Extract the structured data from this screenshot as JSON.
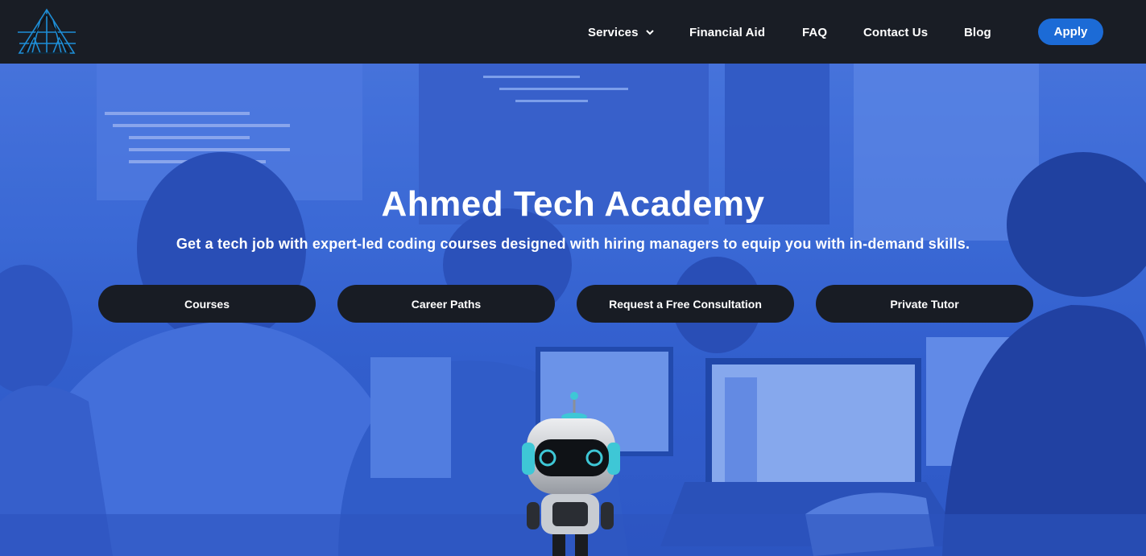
{
  "nav": {
    "items": [
      {
        "label": "Services",
        "has_dropdown": true
      },
      {
        "label": "Financial Aid"
      },
      {
        "label": "FAQ"
      },
      {
        "label": "Contact Us"
      },
      {
        "label": "Blog"
      }
    ],
    "apply_label": "Apply"
  },
  "hero": {
    "title": "Ahmed Tech Academy",
    "subtitle": "Get a tech job with expert-led coding courses designed with hiring managers to equip you with in-demand skills.",
    "buttons": [
      {
        "label": "Courses"
      },
      {
        "label": "Career Paths"
      },
      {
        "label": "Request a Free Consultation"
      },
      {
        "label": "Private Tutor"
      }
    ]
  },
  "colors": {
    "header_bg": "#191d25",
    "accent": "#1c6bd6",
    "hero_tint": "#3f6fd8",
    "cta_bg": "#181c24"
  },
  "icons": {
    "logo": "ata-logo",
    "dropdown": "chevron-down-icon",
    "mascot": "robot-mascot"
  }
}
